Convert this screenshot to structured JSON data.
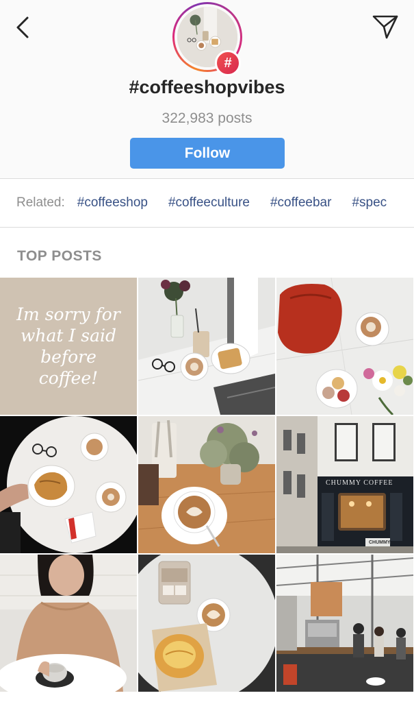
{
  "header": {
    "back_icon": "chevron-left-icon",
    "direct_icon": "paper-plane-icon",
    "hashtag_badge": "#",
    "title": "#coffeeshopvibes",
    "post_count": "322,983 posts",
    "follow_label": "Follow",
    "follow_color": "#4a95e8"
  },
  "related": {
    "label": "Related:",
    "tags": [
      "#coffeeshop",
      "#coffeeculture",
      "#coffeebar",
      "#spec"
    ]
  },
  "top_posts": {
    "title": "TOP POSTS",
    "posts": [
      {
        "kind": "quote",
        "text": "Im sorry for what I said before coffee!"
      },
      {
        "kind": "photo",
        "subject": "coffee-waffle-glasses"
      },
      {
        "kind": "photo",
        "subject": "red-bag-latte-flowers"
      },
      {
        "kind": "photo",
        "subject": "croissant-lattes"
      },
      {
        "kind": "photo",
        "subject": "flat-white-plant"
      },
      {
        "kind": "photo",
        "subject": "chummy-coffee-storefront",
        "sign": "CHUMMY COFFEE",
        "door_sign": "CHUMMY"
      },
      {
        "kind": "photo",
        "subject": "woman-sweater-coffee"
      },
      {
        "kind": "photo",
        "subject": "iced-coffee-pastry"
      },
      {
        "kind": "photo",
        "subject": "cafe-interior"
      }
    ]
  }
}
